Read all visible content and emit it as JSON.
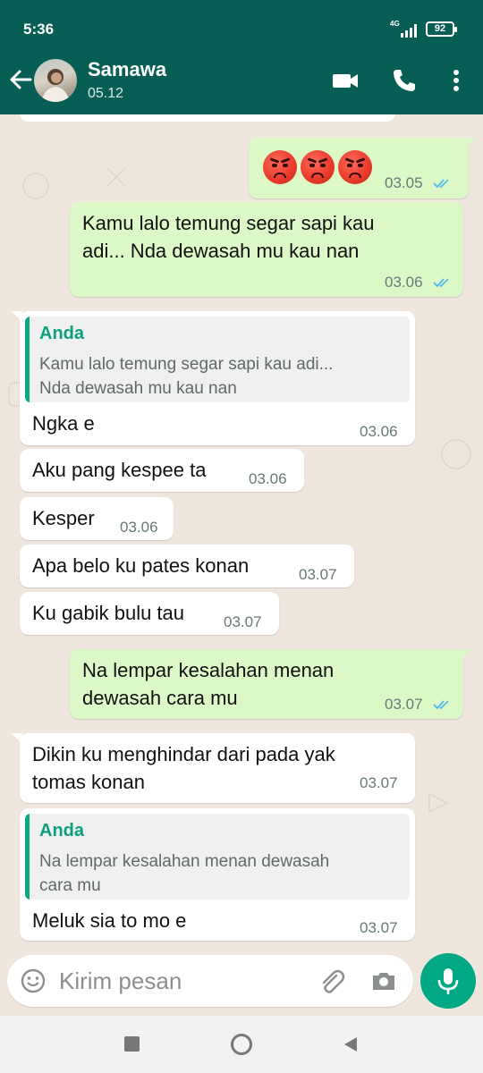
{
  "status": {
    "time": "5:36",
    "network": "4G",
    "battery": "92"
  },
  "header": {
    "contact_name": "Samawa",
    "subtitle": "05.12"
  },
  "messages": [
    {
      "id": "m1",
      "dir": "out",
      "emoji": [
        "angry-face",
        "angry-face",
        "angry-face"
      ],
      "time": "03.05",
      "status": "read"
    },
    {
      "id": "m2",
      "dir": "out",
      "text": "Kamu lalo temung segar sapi kau\nadi... Nda dewasah mu kau nan",
      "time": "03.06",
      "status": "read"
    },
    {
      "id": "m3",
      "dir": "in",
      "quote": {
        "author": "Anda",
        "text": "Kamu lalo temung segar sapi kau adi...\nNda dewasah mu kau nan"
      },
      "text": "Ngka e",
      "time": "03.06"
    },
    {
      "id": "m4",
      "dir": "in",
      "text": "Aku pang kespee ta",
      "time": "03.06"
    },
    {
      "id": "m5",
      "dir": "in",
      "text": "Kesper",
      "time": "03.06"
    },
    {
      "id": "m6",
      "dir": "in",
      "text": "Apa belo ku pates konan",
      "time": "03.07"
    },
    {
      "id": "m7",
      "dir": "in",
      "text": "Ku gabik bulu tau",
      "time": "03.07"
    },
    {
      "id": "m8",
      "dir": "out",
      "text": "Na lempar kesalahan menan\ndewasah cara mu",
      "time": "03.07",
      "status": "read"
    },
    {
      "id": "m9",
      "dir": "in",
      "text": "Dikin ku menghindar dari pada yak\ntomas konan",
      "time": "03.07"
    },
    {
      "id": "m10",
      "dir": "in",
      "quote": {
        "author": "Anda",
        "text": "Na lempar kesalahan menan dewasah\ncara mu"
      },
      "text": "Meluk sia to mo e",
      "time": "03.07"
    }
  ],
  "input": {
    "placeholder": "Kirim pesan"
  },
  "icons": {
    "back": "arrow-left-icon",
    "video": "video-call-icon",
    "call": "phone-icon",
    "menu": "more-vert-icon",
    "emoji": "emoji-icon",
    "attach": "paperclip-icon",
    "camera": "camera-icon",
    "mic": "mic-icon",
    "read": "double-check-icon"
  },
  "colors": {
    "header": "#075e54",
    "outgoing": "#dcf8c6",
    "incoming": "#ffffff",
    "accent": "#00a884",
    "read_tick": "#53bdeb"
  }
}
